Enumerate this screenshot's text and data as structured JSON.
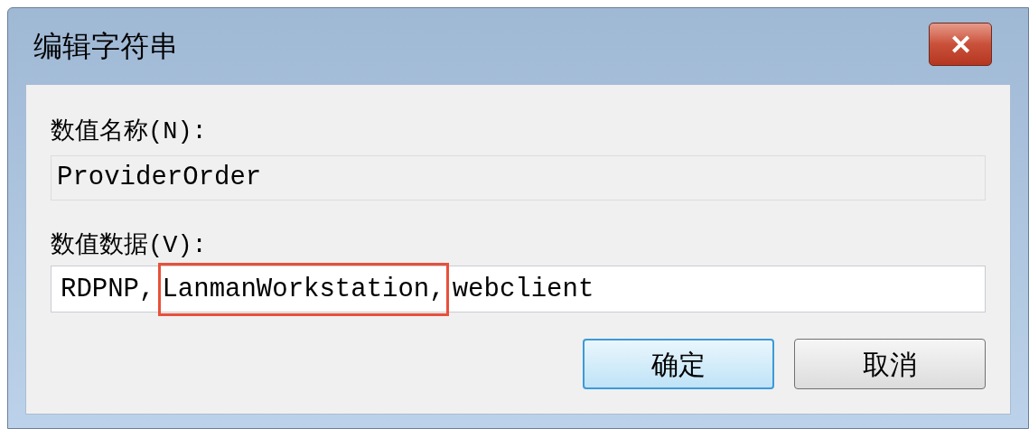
{
  "window": {
    "title": "编辑字符串",
    "close": "✕"
  },
  "name_label": "数值名称(N):",
  "name_field": {
    "value": "ProviderOrder",
    "disabled": true
  },
  "data_label": "数值数据(V):",
  "data_field": {
    "parts": [
      {
        "text": "RDPNP,",
        "highlighted": false
      },
      {
        "text": "LanmanWorkstation,",
        "highlighted": true
      },
      {
        "text": "webclient",
        "highlighted": false
      }
    ]
  },
  "buttons": [
    {
      "label": "确定",
      "default": true
    },
    {
      "label": "取消",
      "default": false
    }
  ]
}
